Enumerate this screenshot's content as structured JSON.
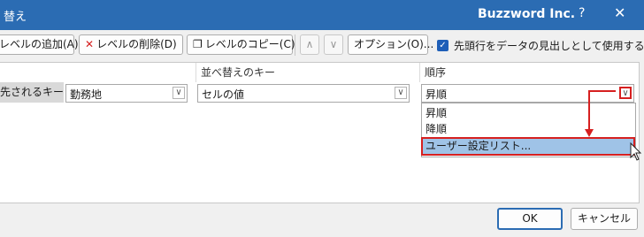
{
  "titlebar": {
    "title": "替え",
    "app": "Buzzword Inc.",
    "help": "?",
    "close": "✕"
  },
  "toolbar": {
    "add_level": "レベルの追加(A)",
    "delete_level": "レベルの削除(D)",
    "copy_level": "レベルのコピー(C)",
    "move_up": "∧",
    "move_down": "∨",
    "options": "オプション(O)...",
    "header_checkbox_label": "先頭行をデータの見出しとして使用する(H)",
    "header_checkbox_checked": true
  },
  "grid": {
    "headers": {
      "sort_on": "並べ替えのキー",
      "order": "順序"
    },
    "row": {
      "label": "先されるキー",
      "column": "勤務地",
      "sort_on": "セルの値",
      "order": "昇順"
    }
  },
  "dropdown": {
    "options": [
      "昇順",
      "降順",
      "ユーザー設定リスト..."
    ],
    "selected_index": 2
  },
  "footer": {
    "ok": "OK",
    "cancel": "キャンセル"
  },
  "colors": {
    "title_bar": "#2b6cb3",
    "highlight": "#d62020",
    "selection": "#9fc3e7"
  }
}
